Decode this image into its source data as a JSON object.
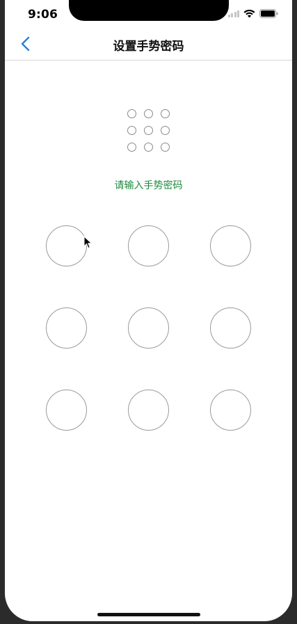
{
  "status_bar": {
    "time": "9:06"
  },
  "navbar": {
    "title": "设置手势密码"
  },
  "hint": {
    "text": "请输入手势密码"
  },
  "colors": {
    "accent_blue": "#2a7fd6",
    "hint_green": "#1f8a3e",
    "circle_gray": "#9a9a9a"
  },
  "icons": {
    "back": "chevron-left-icon",
    "wifi": "wifi-icon",
    "battery": "battery-icon",
    "signal": "cellular-signal-icon"
  }
}
